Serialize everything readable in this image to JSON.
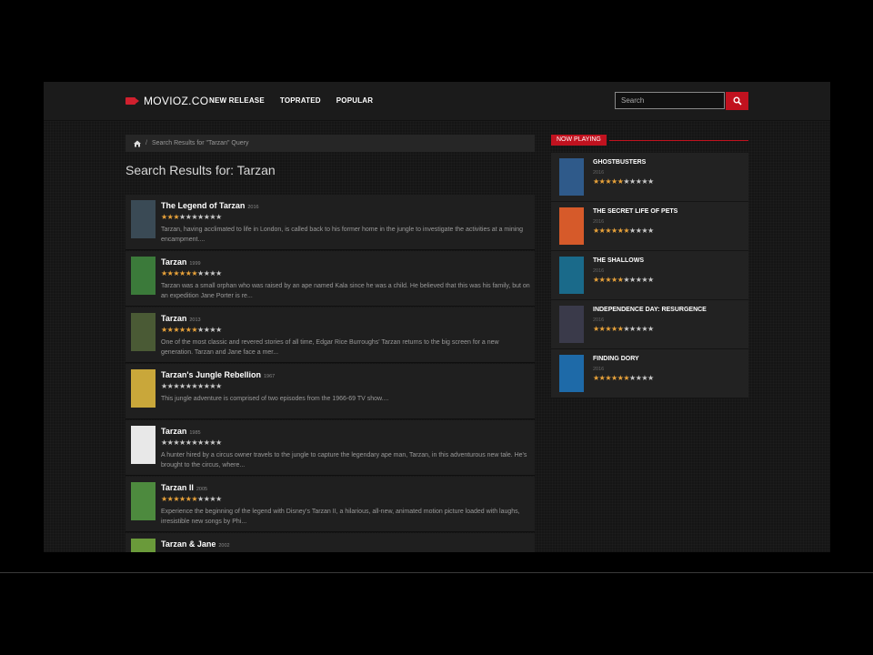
{
  "header": {
    "logo": "MOVIOZ.CO",
    "nav": [
      "NEW RELEASE",
      "TOPRATED",
      "POPULAR"
    ],
    "search_placeholder": "Search"
  },
  "breadcrumb": {
    "text": "Search Results for \"Tarzan\" Query"
  },
  "page_title": "Search Results for: Tarzan",
  "results": [
    {
      "title": "The Legend of Tarzan",
      "year": "2016",
      "stars_on": 3,
      "description": "Tarzan, having acclimated to life in London, is called back to his former home in the jungle to investigate the activities at a mining encampment....",
      "poster_color": "#3a4a55"
    },
    {
      "title": "Tarzan",
      "year": "1999",
      "stars_on": 6,
      "description": "Tarzan was a small orphan who was raised by an ape named Kala since he was a child. He believed that this was his family, but on an expedition Jane Porter is re...",
      "poster_color": "#3b7a3a"
    },
    {
      "title": "Tarzan",
      "year": "2013",
      "stars_on": 6,
      "description": "One of the most classic and revered stories of all time, Edgar Rice Burroughs' Tarzan returns to the big screen for a new generation. Tarzan and Jane face a mer...",
      "poster_color": "#4a5a35"
    },
    {
      "title": "Tarzan's Jungle Rebellion",
      "year": "1967",
      "stars_on": 0,
      "description": "This jungle adventure is comprised of two episodes from the 1966-69 TV show....",
      "poster_color": "#c9a73a"
    },
    {
      "title": "Tarzan",
      "year": "1985",
      "stars_on": 0,
      "description": "A hunter hired by a circus owner travels to the jungle to capture the legendary ape man, Tarzan, in this adventurous new tale. He's brought to the circus, where...",
      "poster_color": "#e8e8e8"
    },
    {
      "title": "Tarzan II",
      "year": "2005",
      "stars_on": 6,
      "description": "Experience the beginning of the legend with Disney's Tarzan II, a hilarious, all-new, animated motion picture loaded with laughs, irresistible new songs by Phi...",
      "poster_color": "#4d8a3e"
    },
    {
      "title": "Tarzan & Jane",
      "year": "2002",
      "stars_on": 6,
      "description": "",
      "poster_color": "#6a9a3a"
    }
  ],
  "now_playing": {
    "label": "NOW PLAYING",
    "items": [
      {
        "title": "GHOSTBUSTERS",
        "year": "2016",
        "stars_on": 5,
        "poster_color": "#2f5a8a"
      },
      {
        "title": "THE SECRET LIFE OF PETS",
        "year": "2016",
        "stars_on": 6,
        "poster_color": "#d65a2a"
      },
      {
        "title": "THE SHALLOWS",
        "year": "2016",
        "stars_on": 5,
        "poster_color": "#1a6a8a"
      },
      {
        "title": "INDEPENDENCE DAY: RESURGENCE",
        "year": "2016",
        "stars_on": 5,
        "poster_color": "#3a3a4a"
      },
      {
        "title": "FINDING DORY",
        "year": "2016",
        "stars_on": 6,
        "poster_color": "#1e6aa8"
      }
    ]
  },
  "stars_total": 10,
  "colors": {
    "accent": "#c1121f",
    "star_on": "#e8a23a",
    "star_off": "#c8c8c8"
  }
}
